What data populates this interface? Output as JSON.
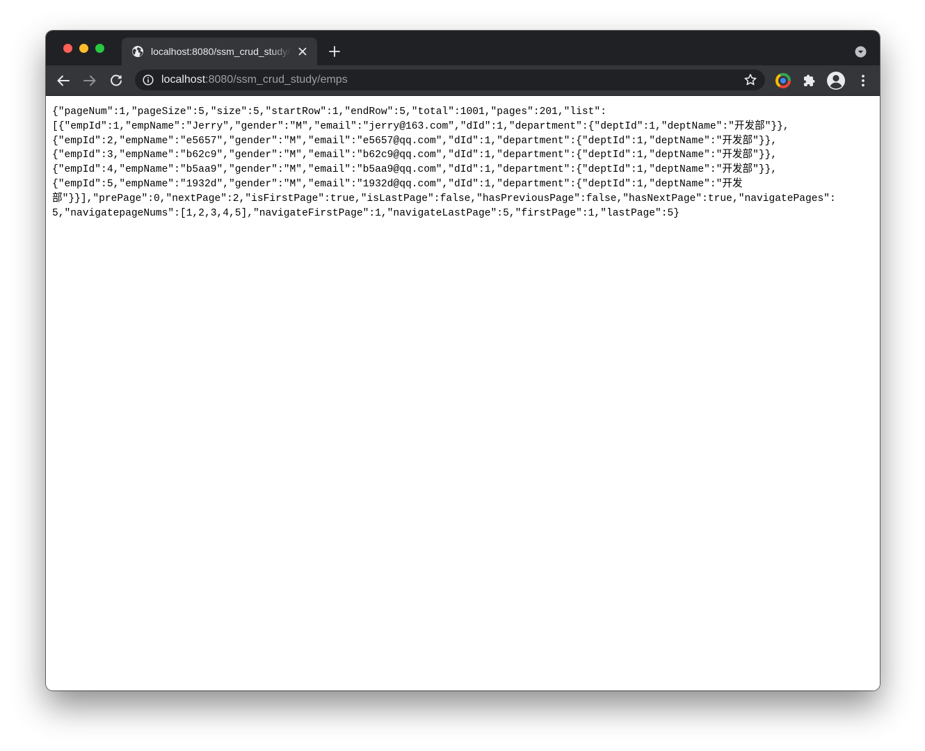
{
  "tab": {
    "title": "localhost:8080/ssm_crud_study/emps"
  },
  "omnibox": {
    "url_host": "localhost",
    "url_rest": ":8080/ssm_crud_study/emps"
  },
  "icons": {
    "tab_favicon": "globe-icon",
    "tab_close": "close-icon",
    "new_tab": "plus-icon",
    "tab_search": "chevron-down-circle-icon",
    "back": "arrow-left-icon",
    "forward": "arrow-right-icon",
    "reload": "reload-icon",
    "site_info": "info-icon",
    "bookmark": "star-icon",
    "extension": "chrome-extension-icon",
    "extensions_menu": "puzzle-icon",
    "profile": "profile-avatar-icon",
    "more": "more-vert-icon"
  },
  "colors": {
    "titlebar": "#202124",
    "toolbar": "#35363a",
    "omnibox": "#202124",
    "traffic_close": "#fe5f57",
    "traffic_minimize": "#febc2e",
    "traffic_maximize": "#28c840"
  },
  "page": {
    "json_lines": [
      "{\"pageNum\":1,\"pageSize\":5,\"size\":5,\"startRow\":1,\"endRow\":5,\"total\":1001,\"pages\":201,\"list\":",
      "[{\"empId\":1,\"empName\":\"Jerry\",\"gender\":\"M\",\"email\":\"jerry@163.com\",\"dId\":1,\"department\":{\"deptId\":1,\"deptName\":\"开发部\"}},",
      "{\"empId\":2,\"empName\":\"e5657\",\"gender\":\"M\",\"email\":\"e5657@qq.com\",\"dId\":1,\"department\":{\"deptId\":1,\"deptName\":\"开发部\"}},",
      "{\"empId\":3,\"empName\":\"b62c9\",\"gender\":\"M\",\"email\":\"b62c9@qq.com\",\"dId\":1,\"department\":{\"deptId\":1,\"deptName\":\"开发部\"}},",
      "{\"empId\":4,\"empName\":\"b5aa9\",\"gender\":\"M\",\"email\":\"b5aa9@qq.com\",\"dId\":1,\"department\":{\"deptId\":1,\"deptName\":\"开发部\"}},",
      "{\"empId\":5,\"empName\":\"1932d\",\"gender\":\"M\",\"email\":\"1932d@qq.com\",\"dId\":1,\"department\":{\"deptId\":1,\"deptName\":\"开发",
      "部\"}}],\"prePage\":0,\"nextPage\":2,\"isFirstPage\":true,\"isLastPage\":false,\"hasPreviousPage\":false,\"hasNextPage\":true,\"navigatePages\":",
      "5,\"navigatepageNums\":[1,2,3,4,5],\"navigateFirstPage\":1,\"navigateLastPage\":5,\"firstPage\":1,\"lastPage\":5}"
    ]
  }
}
